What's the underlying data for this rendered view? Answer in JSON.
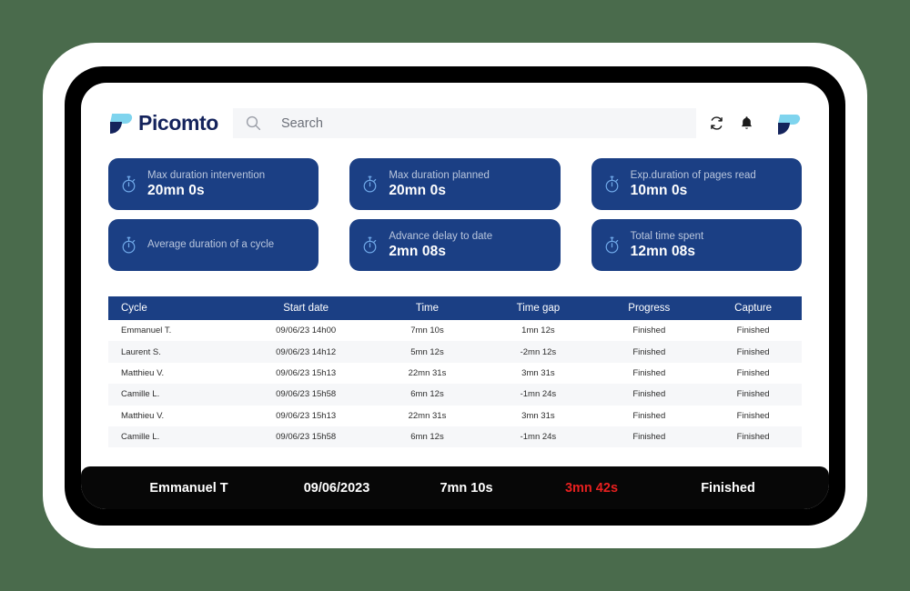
{
  "app": {
    "logo_text": "Picomto",
    "logo_icon": "picomto-logo-mark"
  },
  "search": {
    "placeholder": "Search",
    "value": "",
    "icon": "search-icon"
  },
  "topbar_actions": [
    {
      "name": "refresh-icon",
      "label": "Refresh"
    },
    {
      "name": "bell-icon",
      "label": "Notifications"
    },
    {
      "name": "avatar",
      "label": "Account"
    }
  ],
  "kpis": [
    {
      "icon": "stopwatch-icon",
      "label": "Max duration intervention",
      "value": "20mn 0s"
    },
    {
      "icon": "stopwatch-icon",
      "label": "Max duration planned",
      "value": "20mn 0s"
    },
    {
      "icon": "stopwatch-icon",
      "label": "Exp.duration of pages read",
      "value": "10mn 0s"
    },
    {
      "icon": "stopwatch-icon",
      "label": "Average duration of a cycle",
      "value": ""
    },
    {
      "icon": "stopwatch-icon",
      "label": "Advance delay to date",
      "value": "2mn 08s"
    },
    {
      "icon": "stopwatch-icon",
      "label": "Total time spent",
      "value": "12mn 08s"
    }
  ],
  "table": {
    "headers": [
      "Cycle",
      "Start date",
      "Time",
      "Time gap",
      "Progress",
      "Capture"
    ],
    "rows": [
      {
        "cycle": "Emmanuel T.",
        "start": "09/06/23 14h00",
        "time": "7mn 10s",
        "gap": "1mn 12s",
        "progress": "Finished",
        "capture": "Finished"
      },
      {
        "cycle": "Laurent S.",
        "start": "09/06/23 14h12",
        "time": "5mn 12s",
        "gap": "-2mn 12s",
        "progress": "Finished",
        "capture": "Finished"
      },
      {
        "cycle": "Matthieu V.",
        "start": "09/06/23 15h13",
        "time": "22mn 31s",
        "gap": "3mn 31s",
        "progress": "Finished",
        "capture": "Finished"
      },
      {
        "cycle": "Camille L.",
        "start": "09/06/23 15h58",
        "time": "6mn 12s",
        "gap": "-1mn 24s",
        "progress": "Finished",
        "capture": "Finished"
      },
      {
        "cycle": "Matthieu V.",
        "start": "09/06/23 15h13",
        "time": "22mn 31s",
        "gap": "3mn 31s",
        "progress": "Finished",
        "capture": "Finished"
      },
      {
        "cycle": "Camille L.",
        "start": "09/06/23 15h58",
        "time": "6mn 12s",
        "gap": "-1mn 24s",
        "progress": "Finished",
        "capture": "Finished"
      }
    ]
  },
  "summary": {
    "name": "Emmanuel T",
    "date": "09/06/2023",
    "time": "7mn 10s",
    "gap": "3mn 42s",
    "status": "Finished",
    "gap_color": "#e8201f"
  },
  "colors": {
    "page_background": "#4a6b4c",
    "card_blue": "#1b3f84",
    "brand_navy": "#14235c",
    "brand_cyan": "#7fd4ee",
    "summary_bar": "#070707",
    "row_stripe": "#f6f7f9"
  }
}
